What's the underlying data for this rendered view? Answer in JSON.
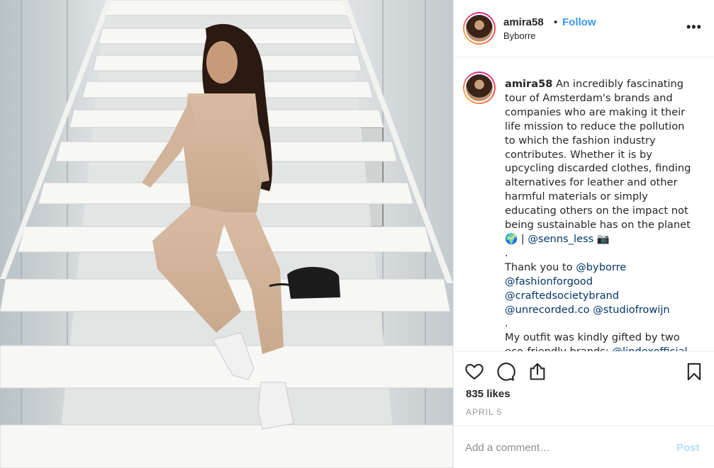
{
  "post": {
    "username": "amira58",
    "dot": "•",
    "follow_label": "Follow",
    "location": "Byborre",
    "more_glyph": "•••",
    "caption_user": "amira58",
    "caption_lines": [
      " An incredibly fascinating",
      "tour of Amsterdam's brands and",
      "companies who are making it their",
      "life mission to reduce the pollution",
      "to which the fashion industry",
      "contributes. Whether it is by",
      "upcycling discarded clothes, finding",
      "alternatives for leather and other",
      "harmful materials or simply",
      "educating others on the impact not",
      "being sustainable has on the planet"
    ],
    "globe_emoji": "🌍",
    "separator": " | ",
    "mention_senns": "@senns_less",
    "camera_emoji": "📷",
    "dot_line": ".",
    "thank_you_prefix": "Thank you to ",
    "mention_byborre": "@byborre",
    "mention_fashionforgood": "@fashionforgood",
    "mention_craftedsociety": "@craftedsocietybrand",
    "mention_unrecorded": "@unrecorded.co",
    "mention_studiofrowijn": "@studiofrowijn",
    "dot_line2": ".",
    "outfit_line": "My outfit was kindly gifted by two",
    "outfit_line2_prefix": "eco-friendly brands: ",
    "mention_lindex": "@lindexofficial"
  },
  "actions": {
    "likes": "835 likes",
    "date": "APRIL 5",
    "icons": [
      "heart-icon",
      "comment-icon",
      "share-icon",
      "bookmark-icon"
    ]
  },
  "comment_box": {
    "placeholder": "Add a comment…",
    "post_label": "Post"
  },
  "colors": {
    "link": "#3897f0",
    "mention": "#003569",
    "post_disabled": "#b2dffc",
    "muted": "#999999",
    "border": "#efefef"
  }
}
